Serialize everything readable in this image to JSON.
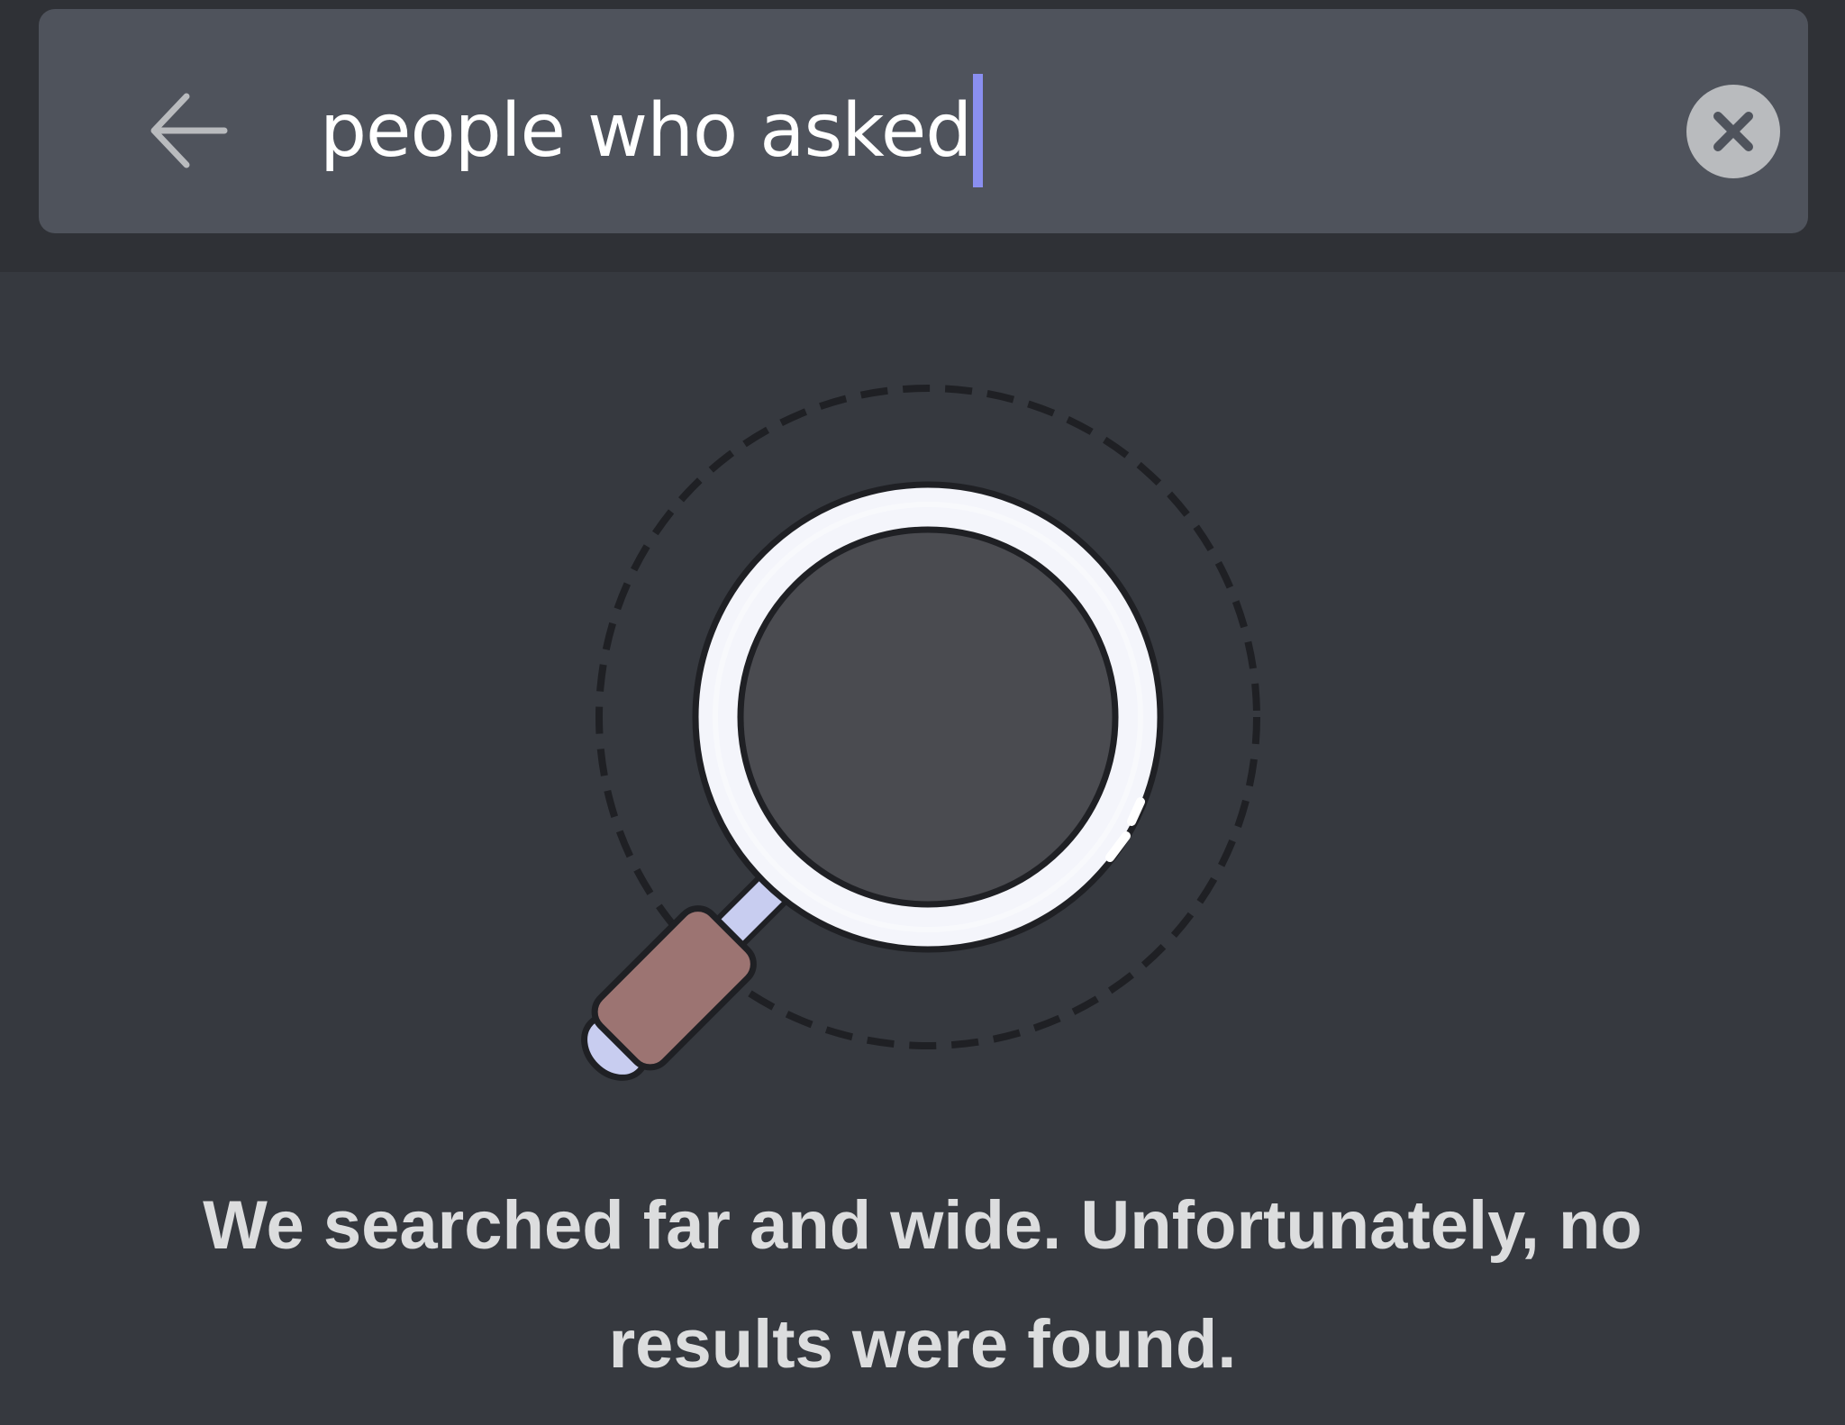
{
  "search": {
    "value": "people who asked",
    "back_icon": "arrow-left-icon",
    "clear_icon": "close-circle-icon"
  },
  "empty_state": {
    "illustration_icon": "magnifying-glass-icon",
    "message": "We searched far and wide. Unfortunately, no results were found."
  },
  "colors": {
    "background": "#36393f",
    "header": "#2f3136",
    "search_bar": "#4f535c",
    "caret": "#8a8ff0",
    "lens": "#4a4b50",
    "handle": "#9c7472"
  }
}
